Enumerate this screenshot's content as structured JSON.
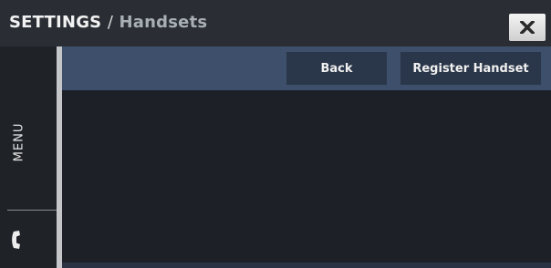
{
  "header": {
    "section": "SETTINGS",
    "separator": "/",
    "page": "Handsets",
    "close_icon": "close-x-icon"
  },
  "sidebar": {
    "menu_label": "MENU",
    "phone_icon": "phone-handset-icon"
  },
  "toolbar": {
    "back_label": "Back",
    "register_label": "Register Handset"
  },
  "colors": {
    "titlebar": "#2a2e34",
    "toolbar": "#3d4f6a",
    "button": "#2a3649",
    "background": "#1d2127"
  }
}
